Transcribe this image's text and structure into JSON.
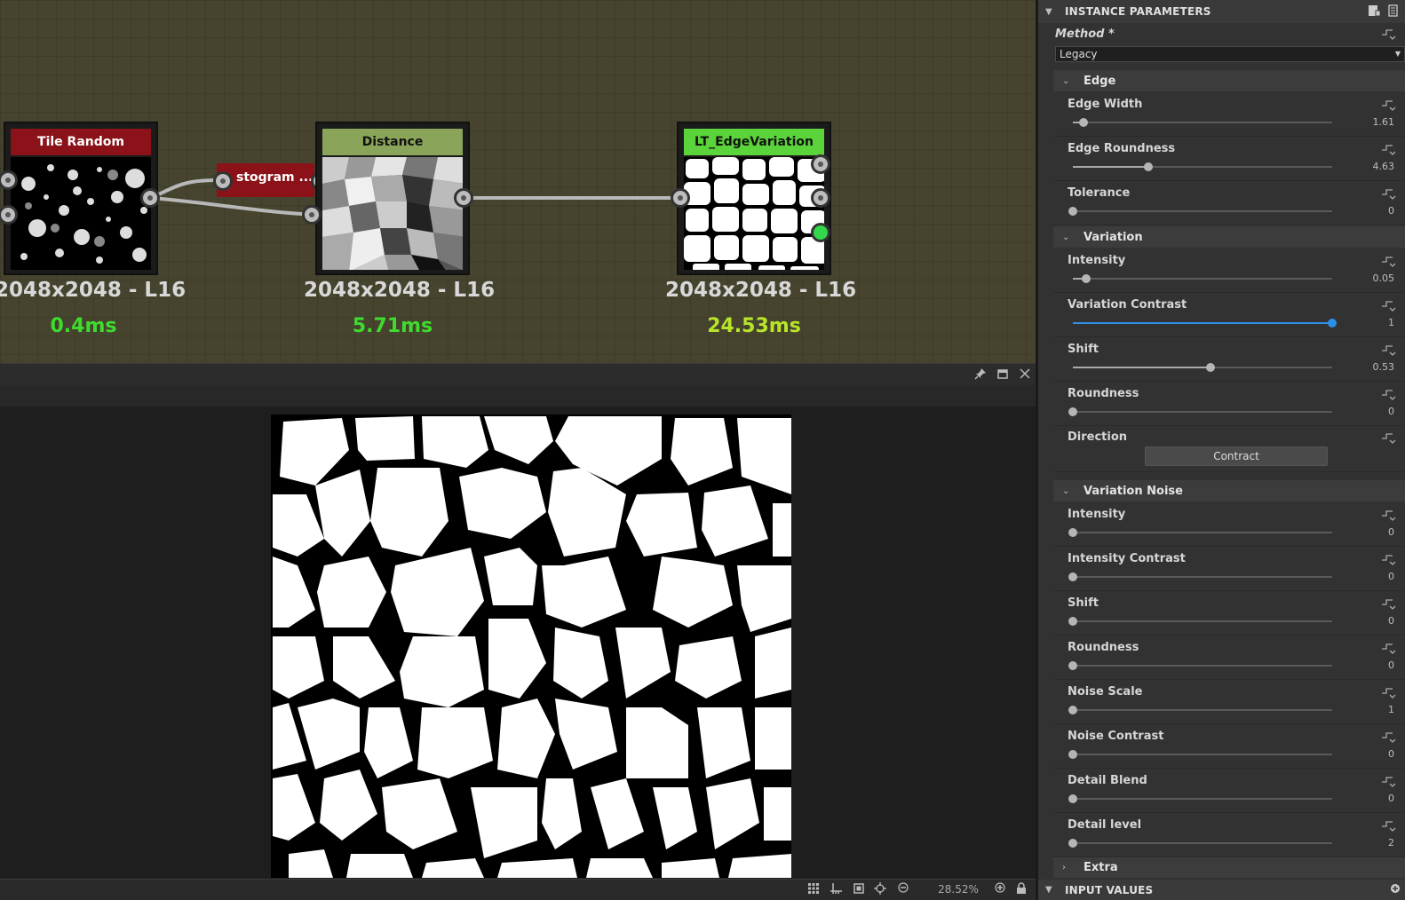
{
  "graph": {
    "nodes": [
      {
        "title": "Tile Random",
        "color": "#8b1218",
        "resolution": "2048x2048 - L16",
        "time": "0.4ms",
        "time_color": "#3fdc2f"
      },
      {
        "title": "stogram ...",
        "color": "#8b1218"
      },
      {
        "title": "Distance",
        "color": "#8aa55a",
        "resolution": "2048x2048 - L16",
        "time": "5.71ms",
        "time_color": "#3fdc2f"
      },
      {
        "title": "LT_EdgeVariation",
        "color": "#5bd33a",
        "resolution": "2048x2048 - L16",
        "time": "24.53ms",
        "time_color": "#b8e52a"
      }
    ]
  },
  "viewer": {
    "zoom": "28.52%",
    "bar_icons": [
      "pin-icon",
      "maximize-icon",
      "close-icon"
    ],
    "foot_icons": [
      "grid-icon",
      "ruler-icon",
      "fit-icon",
      "center-icon",
      "zoom-out-icon",
      "zoom-in-icon",
      "lock-icon"
    ]
  },
  "panel": {
    "title": "INSTANCE PARAMETERS",
    "method_label": "Method *",
    "method_value": "Legacy",
    "groups": {
      "edge": "Edge",
      "variation": "Variation",
      "variation_noise": "Variation Noise",
      "extra": "Extra"
    },
    "edge_params": [
      {
        "label": "Edge Width",
        "value": "1.61",
        "fraction": 0.04
      },
      {
        "label": "Edge Roundness",
        "value": "4.63",
        "fraction": 0.29
      },
      {
        "label": "Tolerance",
        "value": "0",
        "fraction": 0.0
      }
    ],
    "variation_params": [
      {
        "label": "Intensity",
        "value": "0.05",
        "fraction": 0.05
      },
      {
        "label": "Variation Contrast",
        "value": "1",
        "fraction": 1.0,
        "active": true
      },
      {
        "label": "Shift",
        "value": "0.53",
        "fraction": 0.53
      },
      {
        "label": "Roundness",
        "value": "0",
        "fraction": 0.0
      }
    ],
    "direction": {
      "label": "Direction",
      "button": "Contract"
    },
    "noise_params": [
      {
        "label": "Intensity",
        "value": "0",
        "fraction": 0.0
      },
      {
        "label": "Intensity Contrast",
        "value": "0",
        "fraction": 0.0
      },
      {
        "label": "Shift",
        "value": "0",
        "fraction": 0.0
      },
      {
        "label": "Roundness",
        "value": "0",
        "fraction": 0.0
      },
      {
        "label": "Noise Scale",
        "value": "1",
        "fraction": 0.0
      },
      {
        "label": "Noise Contrast",
        "value": "0",
        "fraction": 0.0
      },
      {
        "label": "Detail Blend",
        "value": "0",
        "fraction": 0.0
      },
      {
        "label": "Detail level",
        "value": "2",
        "fraction": 0.0
      }
    ],
    "input_values_title": "INPUT VALUES"
  }
}
